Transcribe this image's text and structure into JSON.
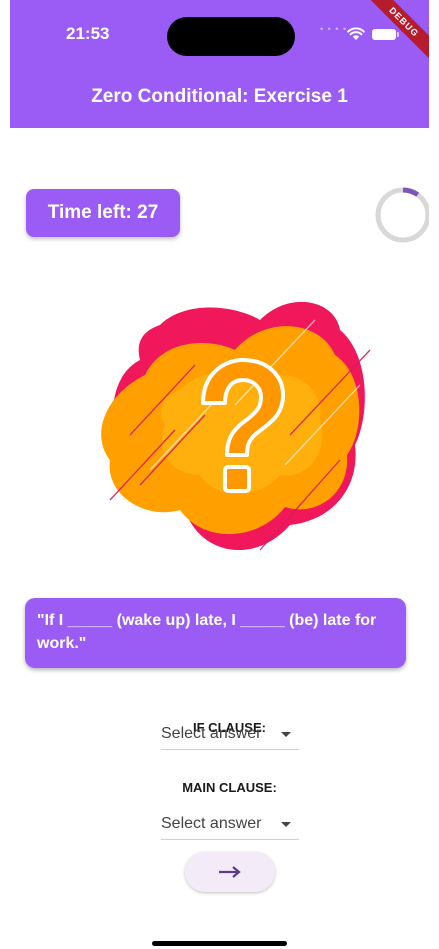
{
  "status_bar": {
    "time": "21:53",
    "debug_label": "DEBUG"
  },
  "app_bar": {
    "title": "Zero Conditional: Exercise 1"
  },
  "timer": {
    "label": "Time left: 27",
    "progress_fraction": 0.1
  },
  "illustration": {
    "icon": "question-mark-icon"
  },
  "question": {
    "text": "\"If I _____ (wake up) late, I _____ (be) late for work.\""
  },
  "if_clause": {
    "label": "IF CLAUSE:",
    "selected": "Select answer"
  },
  "main_clause": {
    "label": "MAIN CLAUSE:",
    "selected": "Select answer"
  },
  "next_button": {
    "icon": "arrow-right-icon"
  },
  "colors": {
    "primary": "#9a5cf5",
    "button_bg": "#f3ecf8",
    "accent_orange": "#ffa000",
    "accent_red": "#f0185a"
  }
}
